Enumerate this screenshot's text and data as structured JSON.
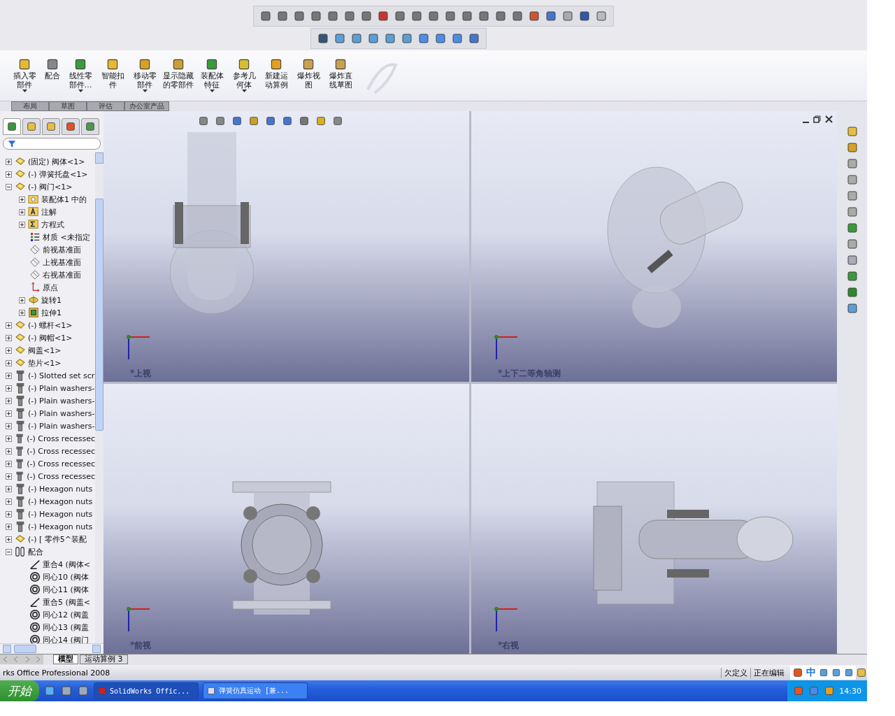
{
  "ribbon": {
    "buttons": [
      {
        "label": "插入零部件",
        "dropdown": true,
        "kind": "insert"
      },
      {
        "label": "配合",
        "dropdown": false,
        "kind": "mate"
      },
      {
        "label": "线性零部件…",
        "dropdown": true,
        "kind": "pattern"
      },
      {
        "label": "智能扣件",
        "dropdown": false,
        "kind": "fastener"
      },
      {
        "label": "移动零部件",
        "dropdown": true,
        "kind": "move"
      },
      {
        "label": "显示隐藏的零部件",
        "dropdown": false,
        "kind": "show"
      },
      {
        "label": "装配体特征",
        "dropdown": true,
        "kind": "feature"
      },
      {
        "label": "参考几何体",
        "dropdown": true,
        "kind": "geometry"
      },
      {
        "label": "新建运动算例",
        "dropdown": false,
        "kind": "motion"
      },
      {
        "label": "爆炸视图",
        "dropdown": false,
        "kind": "explode"
      },
      {
        "label": "爆炸直线草图",
        "dropdown": false,
        "kind": "explode"
      }
    ]
  },
  "command_tabs": [
    {
      "label": "布局",
      "selected": false
    },
    {
      "label": "草图",
      "selected": false
    },
    {
      "label": "评估",
      "selected": false
    },
    {
      "label": "办公室产品",
      "selected": false
    }
  ],
  "pane_tabs": [
    {
      "selected": true
    },
    {
      "selected": false
    },
    {
      "selected": false
    },
    {
      "selected": false
    },
    {
      "selected": false
    }
  ],
  "feature_tree": {
    "items": [
      {
        "label": "(固定) 阀体<1>",
        "kind": "part",
        "expanded": false
      },
      {
        "label": "(-) 弹簧托盘<1>",
        "kind": "part",
        "expanded": false
      },
      {
        "label": "(-) 阀门<1>",
        "kind": "part",
        "expanded": true,
        "children": [
          {
            "label": "装配体1 中的",
            "kind": "folder",
            "expanded": false
          },
          {
            "label": "注解",
            "kind": "annotation",
            "expanded": false
          },
          {
            "label": "方程式",
            "kind": "equation",
            "expanded": false
          },
          {
            "label": "材质 <未指定",
            "kind": "material"
          },
          {
            "label": "前视基准面",
            "kind": "plane"
          },
          {
            "label": "上视基准面",
            "kind": "plane"
          },
          {
            "label": "右视基准面",
            "kind": "plane"
          },
          {
            "label": "原点",
            "kind": "origin"
          },
          {
            "label": "旋转1",
            "kind": "revolve",
            "expanded": false
          },
          {
            "label": "拉伸1",
            "kind": "extrude",
            "expanded": false
          }
        ]
      },
      {
        "label": "(-) 螺杆<1>",
        "kind": "part",
        "expanded": false
      },
      {
        "label": "(-) 阀帽<1>",
        "kind": "part",
        "expanded": false
      },
      {
        "label": "阀盖<1>",
        "kind": "part",
        "expanded": false
      },
      {
        "label": "垫片<1>",
        "kind": "part",
        "expanded": false
      },
      {
        "label": "(-) Slotted set scr",
        "kind": "screw",
        "expanded": false
      },
      {
        "label": "(-) Plain washers-",
        "kind": "screw",
        "expanded": false
      },
      {
        "label": "(-) Plain washers-",
        "kind": "screw",
        "expanded": false
      },
      {
        "label": "(-) Plain washers-",
        "kind": "screw",
        "expanded": false
      },
      {
        "label": "(-) Plain washers-",
        "kind": "screw",
        "expanded": false
      },
      {
        "label": "(-) Cross recessec",
        "kind": "screw",
        "expanded": false
      },
      {
        "label": "(-) Cross recessec",
        "kind": "screw",
        "expanded": false
      },
      {
        "label": "(-) Cross recessec",
        "kind": "screw",
        "expanded": false
      },
      {
        "label": "(-) Cross recessec",
        "kind": "screw",
        "expanded": false
      },
      {
        "label": "(-) Hexagon nuts",
        "kind": "screw",
        "expanded": false
      },
      {
        "label": "(-) Hexagon nuts",
        "kind": "screw",
        "expanded": false
      },
      {
        "label": "(-) Hexagon nuts",
        "kind": "screw",
        "expanded": false
      },
      {
        "label": "(-) Hexagon nuts",
        "kind": "screw",
        "expanded": false
      },
      {
        "label": "(-) [ 零件5^装配",
        "kind": "part",
        "expanded": false
      },
      {
        "label": "配合",
        "kind": "mates",
        "expanded": true,
        "children": [
          {
            "label": "重合4 (阀体<",
            "kind": "coincident"
          },
          {
            "label": "同心10 (阀体",
            "kind": "concentric"
          },
          {
            "label": "同心11 (阀体",
            "kind": "concentric"
          },
          {
            "label": "重合5 (阀盖<",
            "kind": "coincident"
          },
          {
            "label": "同心12 (阀盖",
            "kind": "concentric"
          },
          {
            "label": "同心13 (阀盖",
            "kind": "concentric"
          },
          {
            "label": "同心14 (阀门",
            "kind": "concentric"
          }
        ]
      }
    ]
  },
  "viewports": [
    {
      "label": "*上视",
      "kind": "top"
    },
    {
      "label": "*上下二等角轴测",
      "kind": "iso"
    },
    {
      "label": "*前视",
      "kind": "front"
    },
    {
      "label": "*右视",
      "kind": "right"
    }
  ],
  "bottom_tabs": [
    {
      "label": "模型",
      "selected": true
    },
    {
      "label": "运动算例 3",
      "selected": false
    }
  ],
  "status_bar": {
    "product": "rks Office Professional 2008",
    "state": "欠定义",
    "mode": "正在编辑",
    "ime": "中"
  },
  "taskbar": {
    "start": "开始",
    "tasks": [
      {
        "label": "SolidWorks Offic...",
        "selected": true,
        "kind": "sw"
      },
      {
        "label": "弹簧仿真运动 [兼...",
        "selected": false,
        "kind": "word"
      }
    ],
    "clock": "14:30"
  }
}
